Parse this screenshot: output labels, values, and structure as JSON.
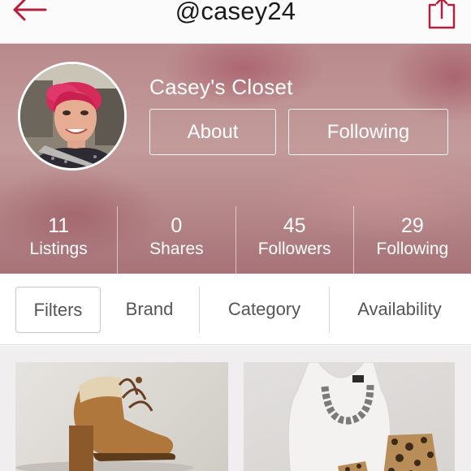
{
  "header": {
    "username": "@casey24",
    "back_icon": "back-arrow-icon",
    "share_icon": "share-icon",
    "accent_color": "#b51f3b"
  },
  "profile": {
    "closet_title": "Casey's Closet",
    "about_label": "About",
    "following_button_label": "Following"
  },
  "stats": [
    {
      "value": "11",
      "label": "Listings"
    },
    {
      "value": "0",
      "label": "Shares"
    },
    {
      "value": "45",
      "label": "Followers"
    },
    {
      "value": "29",
      "label": "Following"
    }
  ],
  "filters": {
    "filters_label": "Filters",
    "brand_label": "Brand",
    "category_label": "Category",
    "availability_label": "Availability"
  },
  "listings": [
    {
      "item": "tan lace-up ankle boot"
    },
    {
      "item": "white tank top, chain necklace, leopard shorts"
    }
  ]
}
